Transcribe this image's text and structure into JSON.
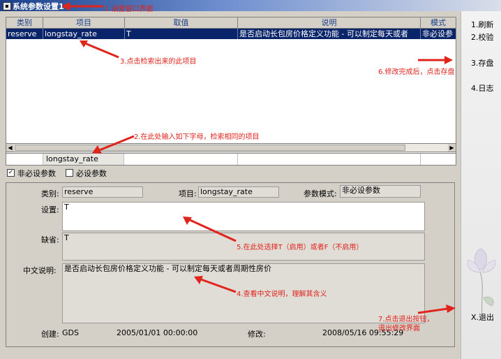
{
  "window": {
    "title": "系统参数设置1"
  },
  "grid": {
    "columns": [
      "类别",
      "项目",
      "取值",
      "说明",
      "模式"
    ],
    "rows": [
      {
        "category": "reserve",
        "item": "longstay_rate",
        "value": "T",
        "description": "是否启动长包房价格定义功能 - 可以制定每天或者",
        "mode": "非必设参"
      }
    ]
  },
  "filter": {
    "item_value": "longstay_rate"
  },
  "checkboxes": {
    "optional": {
      "label": "非必设参数",
      "checked": true,
      "mark": "✓"
    },
    "required": {
      "label": "必设参数",
      "checked": false
    }
  },
  "detail": {
    "category_label": "类别:",
    "category_value": "reserve",
    "item_label": "项目:",
    "item_value": "longstay_rate",
    "mode_label": "参数模式:",
    "mode_value": "非必设参数",
    "setting_label": "设置:",
    "setting_value": "T",
    "default_label": "缺省:",
    "default_value": "T",
    "desc_label": "中文说明:",
    "desc_value": "是否启动长包房价格定义功能 - 可以制定每天或者周期性房价",
    "created_label": "创建:",
    "created_by": "GDS",
    "created_time": "2005/01/01 00:00:00",
    "modified_label": "修改:",
    "modified_time": "2008/05/16 09:55:29"
  },
  "sidebar": {
    "refresh": "1.刷新",
    "verify": "2.校验",
    "save": "3.存盘",
    "log": "4.日志",
    "exit": "X.退出"
  },
  "annotations": {
    "a1": "1.设置窗口界面",
    "a2": "2.在此处输入如下字母，检索相同的项目",
    "a3": "3.点击检索出来的此项目",
    "a4": "4.查看中文说明，理解其含义",
    "a5": "5.在此处选择T（启用）或者F（不启用）",
    "a6": "6.修改完成后，点击存盘",
    "a7_line1": "7.点击退出按钮，",
    "a7_line2": "退出修改界面"
  },
  "colors": {
    "annotation": "#e0241c",
    "selection": "#0a246a",
    "panel": "#d4d0c8"
  }
}
